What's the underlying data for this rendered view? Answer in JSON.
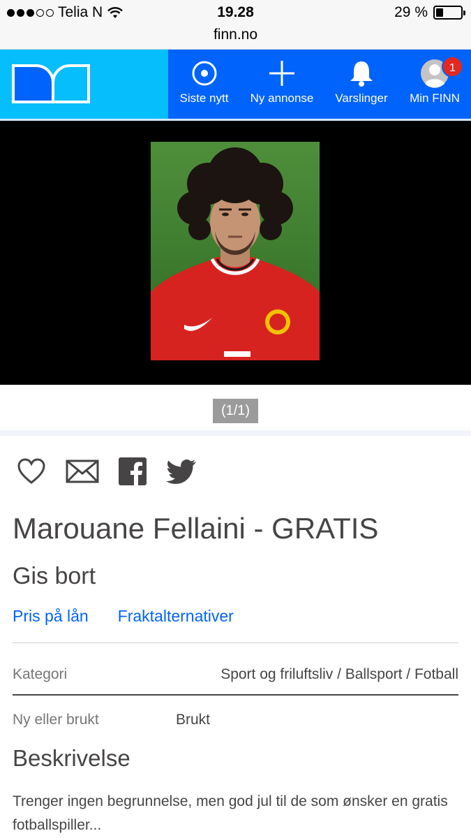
{
  "status_bar": {
    "carrier": "Telia N",
    "time": "19.28",
    "battery": "29 %",
    "battery_level": 0.29
  },
  "browser": {
    "url": "finn.no"
  },
  "nav": {
    "items": [
      {
        "label": "Siste nytt",
        "icon": "target-icon"
      },
      {
        "label": "Ny annonse",
        "icon": "plus-icon"
      },
      {
        "label": "Varslinger",
        "icon": "bell-icon"
      },
      {
        "label": "Min FINN",
        "icon": "avatar-icon"
      }
    ],
    "badge": "1"
  },
  "gallery": {
    "counter": "(1/1)"
  },
  "listing": {
    "title": "Marouane Fellaini - GRATIS",
    "price_text": "Gis bort",
    "links": [
      "Pris på lån",
      "Fraktalternativer"
    ],
    "category_label": "Kategori",
    "category_value": "Sport og friluftsliv / Ballsport / Fotball",
    "condition_label": "Ny eller brukt",
    "condition_value": "Brukt",
    "description_heading": "Beskrivelse",
    "description": "Trenger ingen begrunnelse, men god jul til de som ønsker en gratis fotballspiller..."
  },
  "colors": {
    "header_blue": "#0063fb",
    "logo_cyan": "#06befb",
    "link_blue": "#0063fb",
    "badge_red": "#e3281f"
  }
}
